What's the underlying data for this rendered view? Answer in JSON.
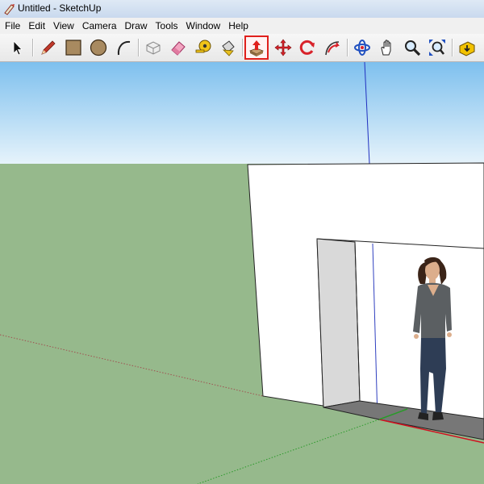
{
  "window": {
    "title": "Untitled - SketchUp"
  },
  "menu": {
    "items": [
      "File",
      "Edit",
      "View",
      "Camera",
      "Draw",
      "Tools",
      "Window",
      "Help"
    ]
  },
  "toolbar": {
    "tools": [
      {
        "name": "select",
        "icon": "arrow-cursor-icon"
      },
      {
        "name": "line",
        "icon": "pencil-icon"
      },
      {
        "name": "rectangle",
        "icon": "rectangle-icon"
      },
      {
        "name": "circle",
        "icon": "circle-icon"
      },
      {
        "name": "arc",
        "icon": "arc-icon"
      },
      {
        "name": "make-component",
        "icon": "component-icon"
      },
      {
        "name": "eraser",
        "icon": "eraser-icon"
      },
      {
        "name": "tape-measure",
        "icon": "tape-measure-icon"
      },
      {
        "name": "paint-bucket",
        "icon": "paint-bucket-icon"
      },
      {
        "name": "push-pull",
        "icon": "push-pull-icon",
        "active": true
      },
      {
        "name": "move",
        "icon": "move-icon"
      },
      {
        "name": "rotate",
        "icon": "rotate-icon"
      },
      {
        "name": "follow-me",
        "icon": "follow-me-icon"
      },
      {
        "name": "orbit",
        "icon": "orbit-icon"
      },
      {
        "name": "pan",
        "icon": "hand-icon"
      },
      {
        "name": "zoom",
        "icon": "magnifier-icon"
      },
      {
        "name": "zoom-extents",
        "icon": "zoom-extents-icon"
      },
      {
        "name": "warehouse",
        "icon": "warehouse-icon"
      }
    ],
    "highlight_color": "#e0201c"
  },
  "scene": {
    "sky_top_color": "#7ec0ee",
    "sky_bottom_color": "#e6f3fb",
    "ground_color": "#96b98c",
    "wall_color": "#ffffff",
    "door_jamb_color": "#d9d9d9",
    "axis_colors": {
      "red": "#d01020",
      "green": "#2a9a2a",
      "blue": "#2030c0"
    }
  }
}
